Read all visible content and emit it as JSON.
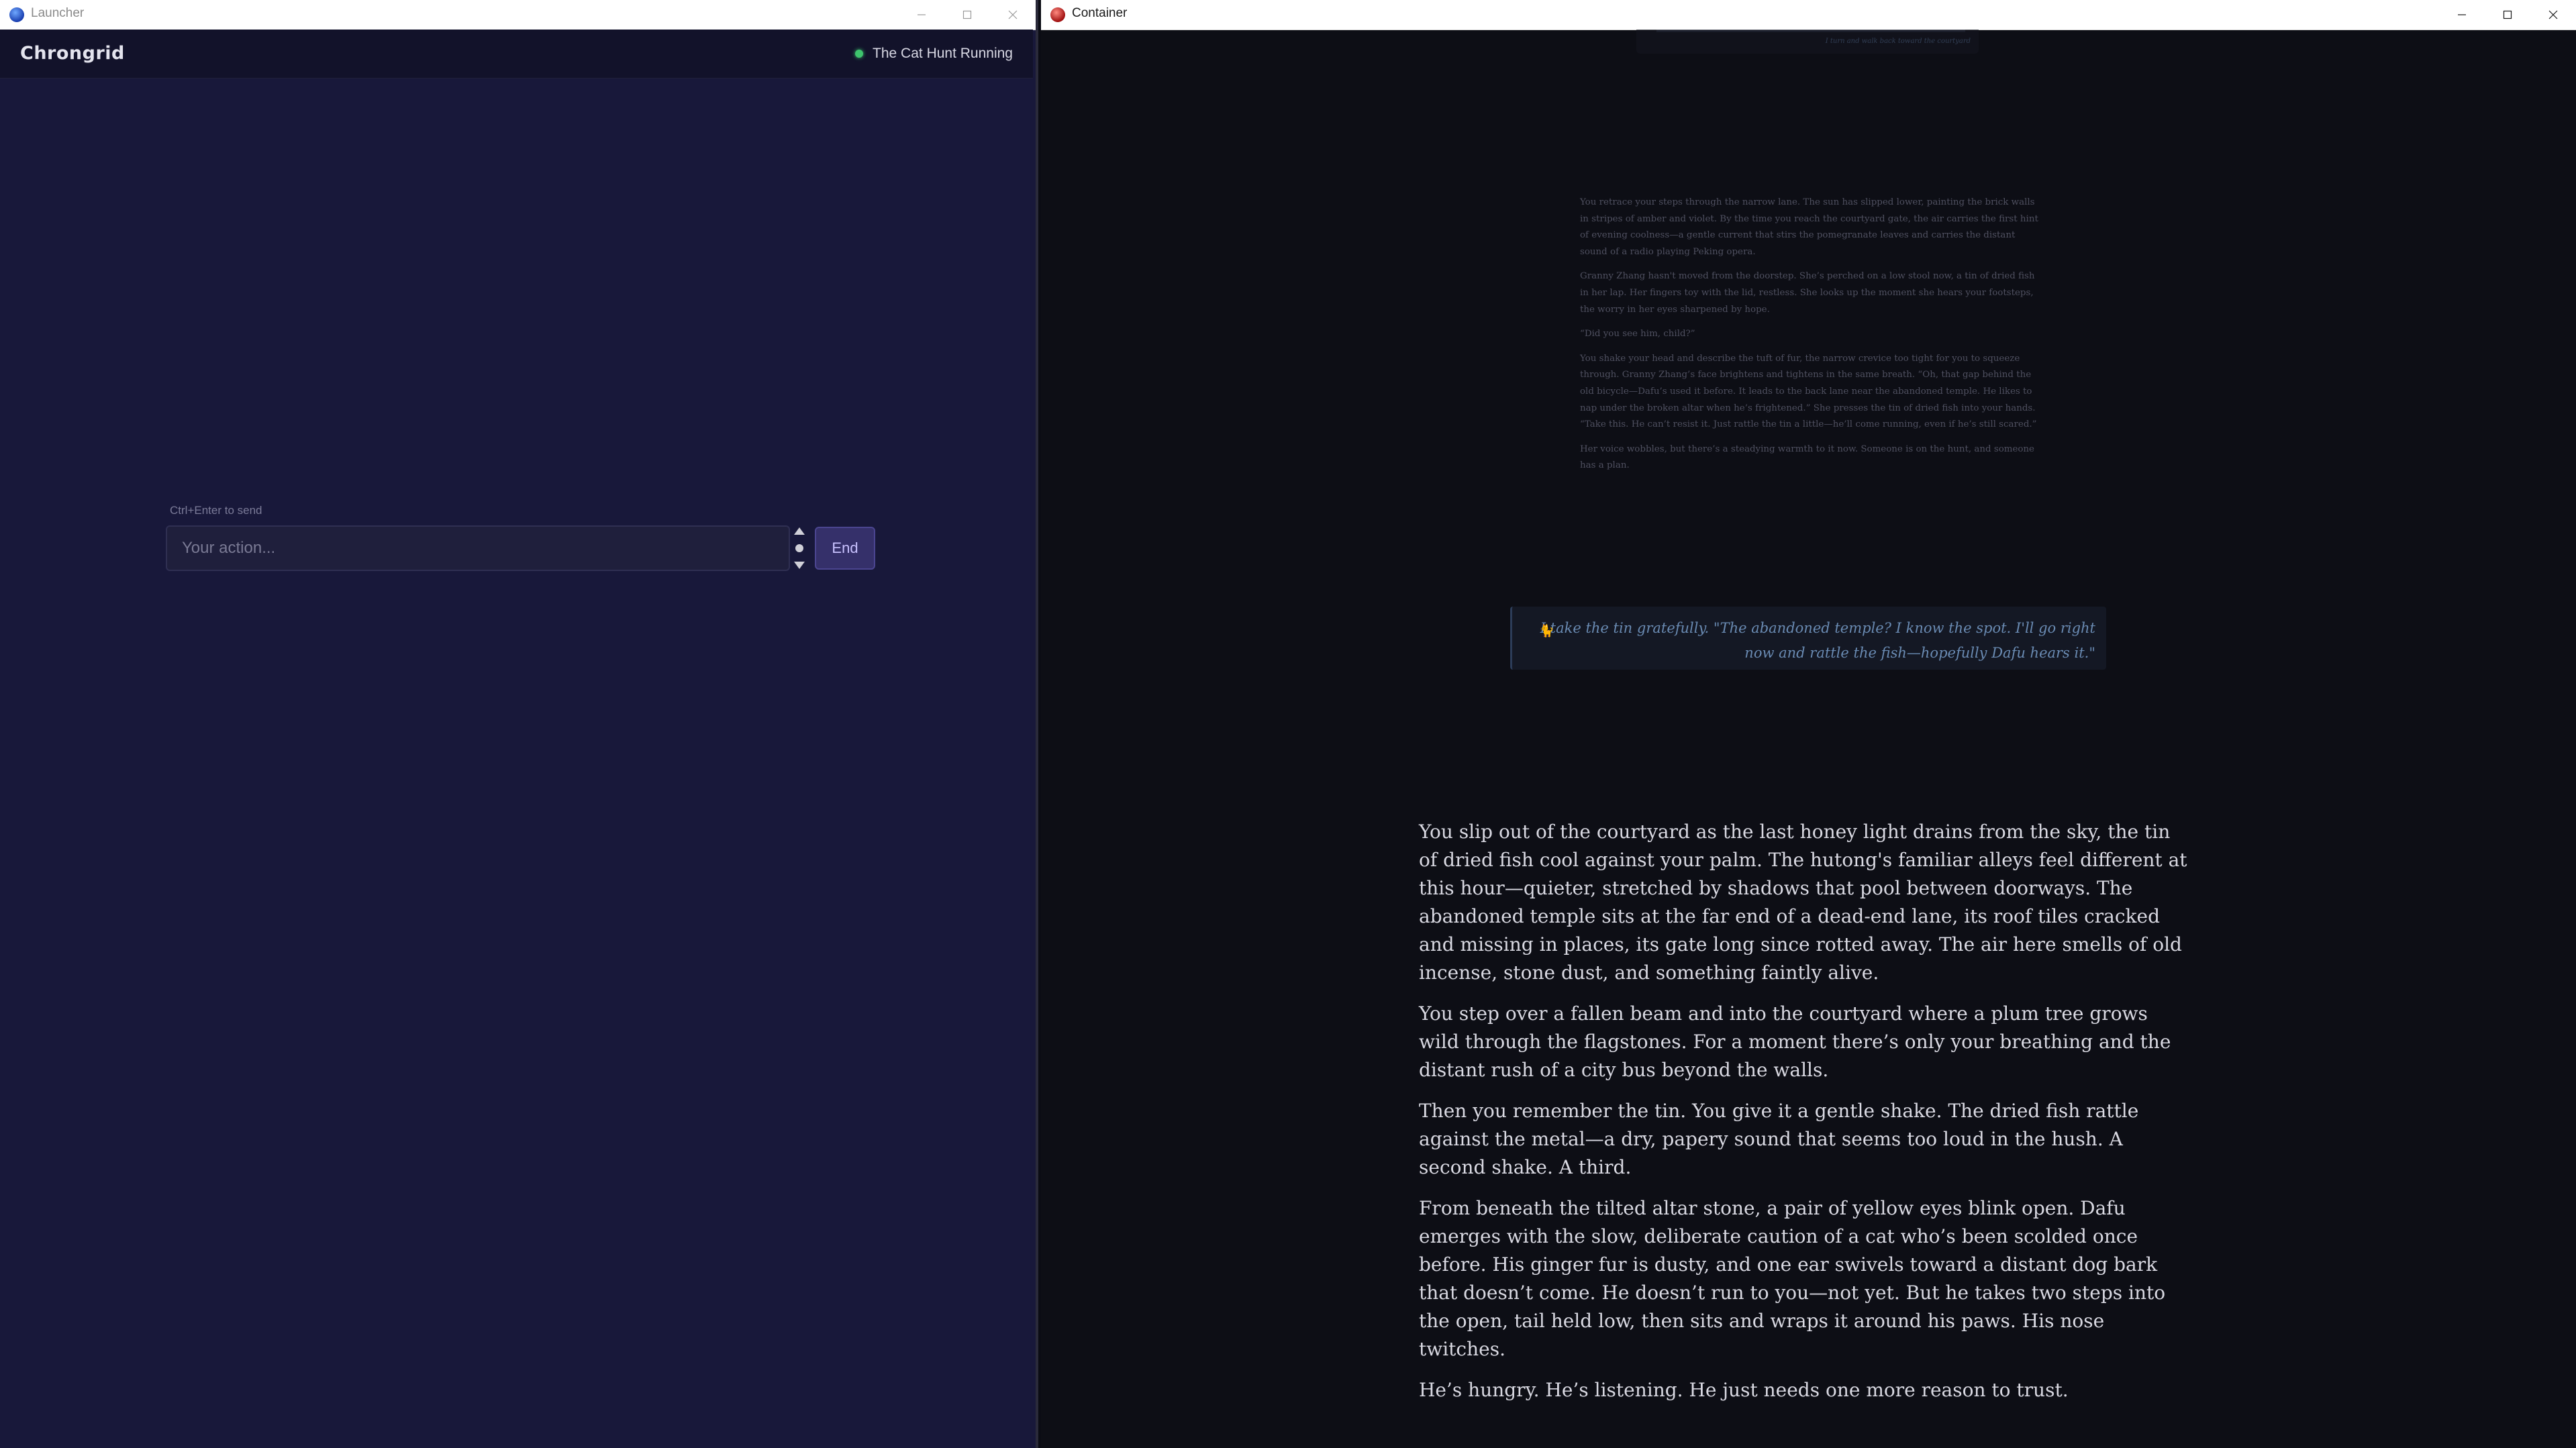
{
  "launcher_window": {
    "title": "Launcher",
    "app_name": "Chrongrid",
    "status_text": "The Cat Hunt Running",
    "input_hint": "Ctrl+Enter to send",
    "input_placeholder": "Your action...",
    "end_label": "End"
  },
  "container_window": {
    "title": "Container",
    "faded_top_text": "I turn and walk back toward the courtyard",
    "faded_story": [
      "You retrace your steps through the narrow lane. The sun has slipped lower, painting the brick walls in stripes of amber and violet. By the time you reach the courtyard gate, the air carries the first hint of evening coolness—a gentle current that stirs the pomegranate leaves and carries the distant sound of a radio playing Peking opera.",
      "Granny Zhang hasn't moved from the doorstep. She’s perched on a low stool now, a tin of dried fish in her lap. Her fingers toy with the lid, restless. She looks up the moment she hears your footsteps, the worry in her eyes sharpened by hope.",
      "“Did you see him, child?”",
      "You shake your head and describe the tuft of fur, the narrow crevice too tight for you to squeeze through. Granny Zhang’s face brightens and tightens in the same breath. “Oh, that gap behind the old bicycle—Dafu’s used it before. It leads to the back lane near the abandoned temple. He likes to nap under the broken altar when he’s frightened.” She presses the tin of dried fish into your hands. “Take this. He can’t resist it. Just rattle the tin a little—he’ll come running, even if he’s still scared.”",
      "Her voice wobbles, but there’s a steadying warmth to it now. Someone is on the hunt, and someone has a plan."
    ],
    "player_quote": "I take the tin gratefully. \"The abandoned temple? I know the spot. I'll go right now and rattle the fish—hopefully Dafu hears it.\"",
    "story": [
      "You slip out of the courtyard as the last honey light drains from the sky, the tin of dried fish cool against your palm. The hutong's familiar alleys feel different at this hour—quieter, stretched by shadows that pool between doorways. The abandoned temple sits at the far end of a dead-end lane, its roof tiles cracked and missing in places, its gate long since rotted away. The air here smells of old incense, stone dust, and something faintly alive.",
      "You step over a fallen beam and into the courtyard where a plum tree grows wild through the flagstones. For a moment there’s only your breathing and the distant rush of a city bus beyond the walls.",
      "Then you remember the tin. You give it a gentle shake. The dried fish rattle against the metal—a dry, papery sound that seems too loud in the hush. A second shake. A third.",
      "From beneath the tilted altar stone, a pair of yellow eyes blink open. Dafu emerges with the slow, deliberate caution of a cat who’s been scolded once before. His ginger fur is dusty, and one ear swivels toward a distant dog bark that doesn’t come. He doesn’t run to you—not yet. But he takes two steps into the open, tail held low, then sits and wraps it around his paws. His nose twitches.",
      "He’s hungry. He’s listening. He just needs one more reason to trust."
    ]
  },
  "colors": {
    "launcher_bg": "#18183a",
    "container_bg": "#0d0e15",
    "status_dot": "#3ec46d",
    "accent": "#35306a"
  }
}
